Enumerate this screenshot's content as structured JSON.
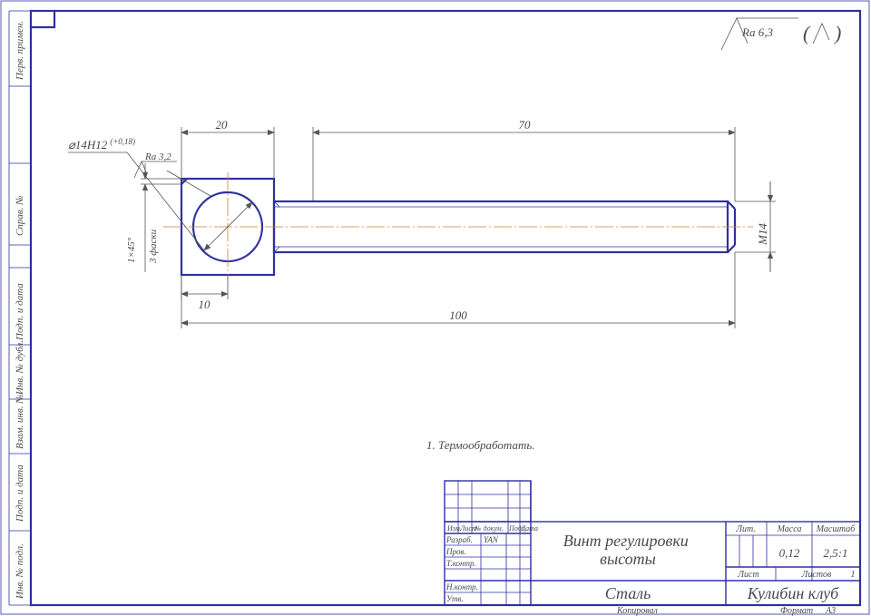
{
  "surface_finish": {
    "default": "Ra 6,3",
    "hole_face": "Ra 3,2"
  },
  "dimensions": {
    "head_width": "20",
    "shaft_len": "70",
    "head_bottom_offset": "10",
    "overall_len": "100",
    "thread": "M14",
    "hole": "⌀14H12",
    "hole_tolerance": "(+0,18)",
    "chamfer": "1×45°",
    "chamfer_note": "3 фаски"
  },
  "notes": {
    "n1": "1. Термообработать."
  },
  "title_block": {
    "rows_left_header": [
      "Изм.",
      "Лист",
      "№ докум.",
      "Подп.",
      "Дата"
    ],
    "rows_left": [
      [
        "Разраб.",
        "YAN",
        "",
        ""
      ],
      [
        "Пров.",
        "",
        "",
        ""
      ],
      [
        "Т.контр.",
        "",
        "",
        ""
      ],
      [
        "Н.контр.",
        "",
        "",
        ""
      ],
      [
        "Утв.",
        "",
        "",
        ""
      ]
    ],
    "title": "Винт регулировки высоты",
    "material": "Сталь",
    "org": "Кулибин клуб",
    "lit_hdr": "Лит.",
    "mass_hdr": "Масса",
    "scale_hdr": "Масштаб",
    "mass": "0,12",
    "scale": "2,5:1",
    "sheet_hdr": "Лист",
    "sheets_hdr": "Листов",
    "sheets": "1",
    "footer_left": "Копировал",
    "footer_right_label": "Формат",
    "footer_right_val": "А3"
  },
  "left_margin_cells": [
    "Инв. № подл.",
    "Подп. и дата",
    "Взам. инв. №",
    "Инв. № дубл.",
    "Подп. и дата",
    "Справ. №",
    "Перв. примен."
  ]
}
